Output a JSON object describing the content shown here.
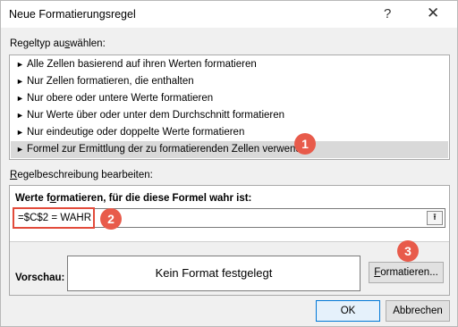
{
  "window": {
    "title": "Neue Formatierungsregel",
    "help_glyph": "?",
    "close_glyph": "✕"
  },
  "rule_type": {
    "label_pre": "Regeltyp au",
    "label_accel": "s",
    "label_post": "wählen:",
    "items": [
      {
        "label": "Alle Zellen basierend auf ihren Werten formatieren"
      },
      {
        "label": "Nur Zellen formatieren, die enthalten"
      },
      {
        "label": "Nur obere oder untere Werte formatieren"
      },
      {
        "label": "Nur Werte über oder unter dem Durchschnitt formatieren"
      },
      {
        "label": "Nur eindeutige oder doppelte Werte formatieren"
      },
      {
        "label": "Formel zur Ermittlung der zu formatierenden Zellen verwenden"
      }
    ],
    "bullet": "►",
    "selected_index": 5
  },
  "description": {
    "label_accel": "R",
    "label_post": "egelbeschreibung bearbeiten:",
    "formula_label_pre": "Werte f",
    "formula_label_accel": "o",
    "formula_label_post": "rmatieren, für die diese Formel wahr ist:",
    "formula_value": "=$C$2 = WAHR",
    "collapse_icon": "⭱"
  },
  "preview": {
    "label": "Vorschau:",
    "text": "Kein Format festgelegt"
  },
  "buttons": {
    "format_accel": "F",
    "format_post": "ormatieren...",
    "ok": "OK",
    "cancel": "Abbrechen"
  },
  "annotations": {
    "badge1": "1",
    "badge2": "2",
    "badge3": "3",
    "color": "#e85b4b"
  }
}
